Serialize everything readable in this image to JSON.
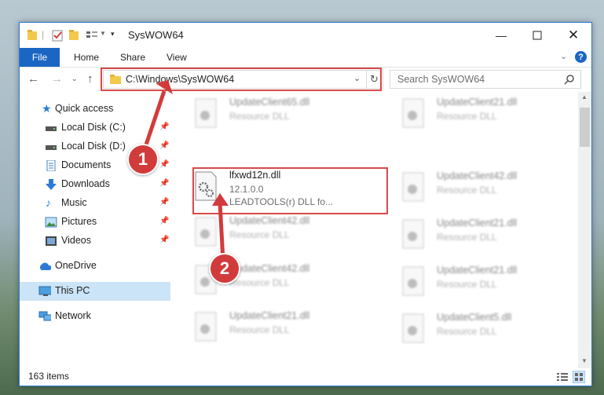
{
  "window": {
    "title": "SysWOW64"
  },
  "ribbon": {
    "tabs": [
      "File",
      "Home",
      "Share",
      "View"
    ]
  },
  "nav": {
    "address": "C:\\Windows\\SysWOW64",
    "search_placeholder": "Search SysWOW64"
  },
  "sidebar": {
    "items": [
      {
        "label": "Quick access",
        "icon": "star-icon"
      },
      {
        "label": "Local Disk (C:)",
        "icon": "drive-icon"
      },
      {
        "label": "Local Disk (D:)",
        "icon": "drive-icon"
      },
      {
        "label": "Documents",
        "icon": "documents-icon"
      },
      {
        "label": "Downloads",
        "icon": "download-icon"
      },
      {
        "label": "Music",
        "icon": "music-icon"
      },
      {
        "label": "Pictures",
        "icon": "pictures-icon"
      },
      {
        "label": "Videos",
        "icon": "videos-icon"
      },
      {
        "label": "OneDrive",
        "icon": "cloud-icon"
      },
      {
        "label": "This PC",
        "icon": "computer-icon"
      },
      {
        "label": "Network",
        "icon": "network-icon"
      }
    ]
  },
  "files": {
    "highlighted": {
      "name": "lfxwd12n.dll",
      "version": "12.1.0.0",
      "description": "LEADTOOLS(r) DLL fo..."
    },
    "blurred": [
      {
        "name": "UpdateClient65.dll",
        "type": "Resource DLL"
      },
      {
        "name": "UpdateClient21.dll",
        "type": "Resource DLL"
      },
      {
        "name": "UpdateClient42.dll",
        "type": "Resource DLL"
      },
      {
        "name": "UpdateClient42.dll",
        "type": "Resource DLL"
      },
      {
        "name": "UpdateClient21.dll",
        "type": "Resource DLL"
      },
      {
        "name": "UpdateClient42.dll",
        "type": "Resource DLL"
      },
      {
        "name": "UpdateClient21.dll",
        "type": "Resource DLL"
      },
      {
        "name": "UpdateClient21.dll",
        "type": "Resource DLL"
      },
      {
        "name": "UpdateClient5.dll",
        "type": "Resource DLL"
      }
    ]
  },
  "status": {
    "count": "163 items"
  },
  "annotations": {
    "step1": "1",
    "step2": "2"
  },
  "colors": {
    "accent": "#1a66c2",
    "annotation": "#d23b3b",
    "selected": "#cce4f7"
  }
}
